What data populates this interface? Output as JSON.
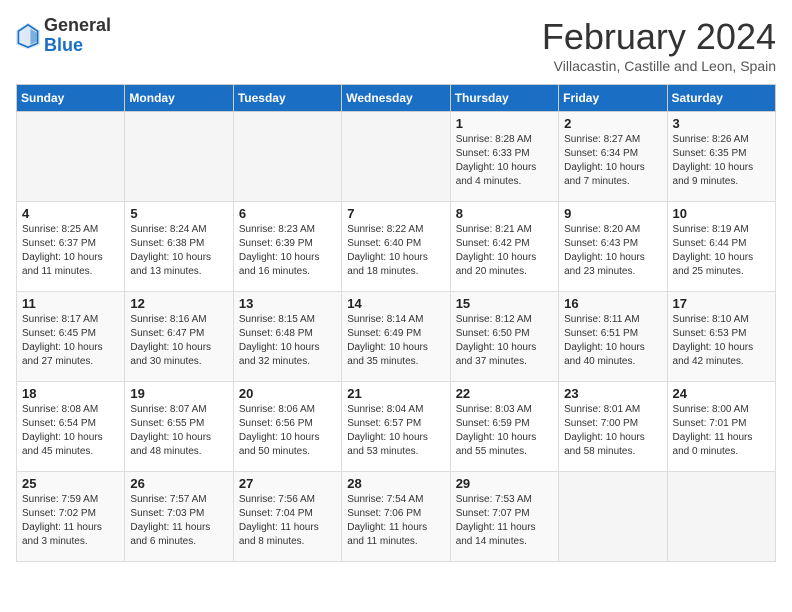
{
  "header": {
    "logo_general": "General",
    "logo_blue": "Blue",
    "month_title": "February 2024",
    "subtitle": "Villacastin, Castille and Leon, Spain"
  },
  "days_of_week": [
    "Sunday",
    "Monday",
    "Tuesday",
    "Wednesday",
    "Thursday",
    "Friday",
    "Saturday"
  ],
  "weeks": [
    [
      {
        "num": "",
        "sunrise": "",
        "sunset": "",
        "daylight": ""
      },
      {
        "num": "",
        "sunrise": "",
        "sunset": "",
        "daylight": ""
      },
      {
        "num": "",
        "sunrise": "",
        "sunset": "",
        "daylight": ""
      },
      {
        "num": "",
        "sunrise": "",
        "sunset": "",
        "daylight": ""
      },
      {
        "num": "1",
        "sunrise": "Sunrise: 8:28 AM",
        "sunset": "Sunset: 6:33 PM",
        "daylight": "Daylight: 10 hours and 4 minutes."
      },
      {
        "num": "2",
        "sunrise": "Sunrise: 8:27 AM",
        "sunset": "Sunset: 6:34 PM",
        "daylight": "Daylight: 10 hours and 7 minutes."
      },
      {
        "num": "3",
        "sunrise": "Sunrise: 8:26 AM",
        "sunset": "Sunset: 6:35 PM",
        "daylight": "Daylight: 10 hours and 9 minutes."
      }
    ],
    [
      {
        "num": "4",
        "sunrise": "Sunrise: 8:25 AM",
        "sunset": "Sunset: 6:37 PM",
        "daylight": "Daylight: 10 hours and 11 minutes."
      },
      {
        "num": "5",
        "sunrise": "Sunrise: 8:24 AM",
        "sunset": "Sunset: 6:38 PM",
        "daylight": "Daylight: 10 hours and 13 minutes."
      },
      {
        "num": "6",
        "sunrise": "Sunrise: 8:23 AM",
        "sunset": "Sunset: 6:39 PM",
        "daylight": "Daylight: 10 hours and 16 minutes."
      },
      {
        "num": "7",
        "sunrise": "Sunrise: 8:22 AM",
        "sunset": "Sunset: 6:40 PM",
        "daylight": "Daylight: 10 hours and 18 minutes."
      },
      {
        "num": "8",
        "sunrise": "Sunrise: 8:21 AM",
        "sunset": "Sunset: 6:42 PM",
        "daylight": "Daylight: 10 hours and 20 minutes."
      },
      {
        "num": "9",
        "sunrise": "Sunrise: 8:20 AM",
        "sunset": "Sunset: 6:43 PM",
        "daylight": "Daylight: 10 hours and 23 minutes."
      },
      {
        "num": "10",
        "sunrise": "Sunrise: 8:19 AM",
        "sunset": "Sunset: 6:44 PM",
        "daylight": "Daylight: 10 hours and 25 minutes."
      }
    ],
    [
      {
        "num": "11",
        "sunrise": "Sunrise: 8:17 AM",
        "sunset": "Sunset: 6:45 PM",
        "daylight": "Daylight: 10 hours and 27 minutes."
      },
      {
        "num": "12",
        "sunrise": "Sunrise: 8:16 AM",
        "sunset": "Sunset: 6:47 PM",
        "daylight": "Daylight: 10 hours and 30 minutes."
      },
      {
        "num": "13",
        "sunrise": "Sunrise: 8:15 AM",
        "sunset": "Sunset: 6:48 PM",
        "daylight": "Daylight: 10 hours and 32 minutes."
      },
      {
        "num": "14",
        "sunrise": "Sunrise: 8:14 AM",
        "sunset": "Sunset: 6:49 PM",
        "daylight": "Daylight: 10 hours and 35 minutes."
      },
      {
        "num": "15",
        "sunrise": "Sunrise: 8:12 AM",
        "sunset": "Sunset: 6:50 PM",
        "daylight": "Daylight: 10 hours and 37 minutes."
      },
      {
        "num": "16",
        "sunrise": "Sunrise: 8:11 AM",
        "sunset": "Sunset: 6:51 PM",
        "daylight": "Daylight: 10 hours and 40 minutes."
      },
      {
        "num": "17",
        "sunrise": "Sunrise: 8:10 AM",
        "sunset": "Sunset: 6:53 PM",
        "daylight": "Daylight: 10 hours and 42 minutes."
      }
    ],
    [
      {
        "num": "18",
        "sunrise": "Sunrise: 8:08 AM",
        "sunset": "Sunset: 6:54 PM",
        "daylight": "Daylight: 10 hours and 45 minutes."
      },
      {
        "num": "19",
        "sunrise": "Sunrise: 8:07 AM",
        "sunset": "Sunset: 6:55 PM",
        "daylight": "Daylight: 10 hours and 48 minutes."
      },
      {
        "num": "20",
        "sunrise": "Sunrise: 8:06 AM",
        "sunset": "Sunset: 6:56 PM",
        "daylight": "Daylight: 10 hours and 50 minutes."
      },
      {
        "num": "21",
        "sunrise": "Sunrise: 8:04 AM",
        "sunset": "Sunset: 6:57 PM",
        "daylight": "Daylight: 10 hours and 53 minutes."
      },
      {
        "num": "22",
        "sunrise": "Sunrise: 8:03 AM",
        "sunset": "Sunset: 6:59 PM",
        "daylight": "Daylight: 10 hours and 55 minutes."
      },
      {
        "num": "23",
        "sunrise": "Sunrise: 8:01 AM",
        "sunset": "Sunset: 7:00 PM",
        "daylight": "Daylight: 10 hours and 58 minutes."
      },
      {
        "num": "24",
        "sunrise": "Sunrise: 8:00 AM",
        "sunset": "Sunset: 7:01 PM",
        "daylight": "Daylight: 11 hours and 0 minutes."
      }
    ],
    [
      {
        "num": "25",
        "sunrise": "Sunrise: 7:59 AM",
        "sunset": "Sunset: 7:02 PM",
        "daylight": "Daylight: 11 hours and 3 minutes."
      },
      {
        "num": "26",
        "sunrise": "Sunrise: 7:57 AM",
        "sunset": "Sunset: 7:03 PM",
        "daylight": "Daylight: 11 hours and 6 minutes."
      },
      {
        "num": "27",
        "sunrise": "Sunrise: 7:56 AM",
        "sunset": "Sunset: 7:04 PM",
        "daylight": "Daylight: 11 hours and 8 minutes."
      },
      {
        "num": "28",
        "sunrise": "Sunrise: 7:54 AM",
        "sunset": "Sunset: 7:06 PM",
        "daylight": "Daylight: 11 hours and 11 minutes."
      },
      {
        "num": "29",
        "sunrise": "Sunrise: 7:53 AM",
        "sunset": "Sunset: 7:07 PM",
        "daylight": "Daylight: 11 hours and 14 minutes."
      },
      {
        "num": "",
        "sunrise": "",
        "sunset": "",
        "daylight": ""
      },
      {
        "num": "",
        "sunrise": "",
        "sunset": "",
        "daylight": ""
      }
    ]
  ]
}
